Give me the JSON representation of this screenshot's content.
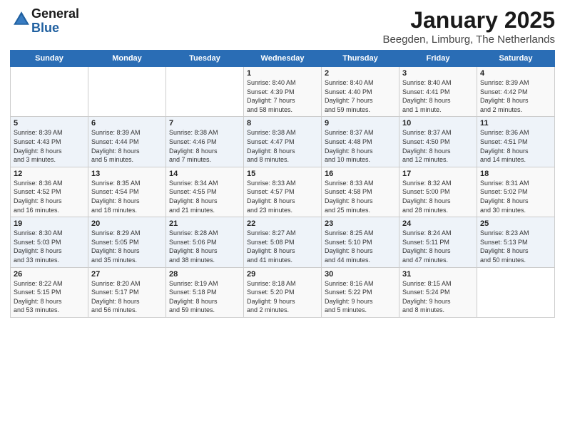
{
  "logo": {
    "general": "General",
    "blue": "Blue"
  },
  "title": "January 2025",
  "subtitle": "Beegden, Limburg, The Netherlands",
  "days_of_week": [
    "Sunday",
    "Monday",
    "Tuesday",
    "Wednesday",
    "Thursday",
    "Friday",
    "Saturday"
  ],
  "weeks": [
    [
      {
        "day": "",
        "text": ""
      },
      {
        "day": "",
        "text": ""
      },
      {
        "day": "",
        "text": ""
      },
      {
        "day": "1",
        "text": "Sunrise: 8:40 AM\nSunset: 4:39 PM\nDaylight: 7 hours\nand 58 minutes."
      },
      {
        "day": "2",
        "text": "Sunrise: 8:40 AM\nSunset: 4:40 PM\nDaylight: 7 hours\nand 59 minutes."
      },
      {
        "day": "3",
        "text": "Sunrise: 8:40 AM\nSunset: 4:41 PM\nDaylight: 8 hours\nand 1 minute."
      },
      {
        "day": "4",
        "text": "Sunrise: 8:39 AM\nSunset: 4:42 PM\nDaylight: 8 hours\nand 2 minutes."
      }
    ],
    [
      {
        "day": "5",
        "text": "Sunrise: 8:39 AM\nSunset: 4:43 PM\nDaylight: 8 hours\nand 3 minutes."
      },
      {
        "day": "6",
        "text": "Sunrise: 8:39 AM\nSunset: 4:44 PM\nDaylight: 8 hours\nand 5 minutes."
      },
      {
        "day": "7",
        "text": "Sunrise: 8:38 AM\nSunset: 4:46 PM\nDaylight: 8 hours\nand 7 minutes."
      },
      {
        "day": "8",
        "text": "Sunrise: 8:38 AM\nSunset: 4:47 PM\nDaylight: 8 hours\nand 8 minutes."
      },
      {
        "day": "9",
        "text": "Sunrise: 8:37 AM\nSunset: 4:48 PM\nDaylight: 8 hours\nand 10 minutes."
      },
      {
        "day": "10",
        "text": "Sunrise: 8:37 AM\nSunset: 4:50 PM\nDaylight: 8 hours\nand 12 minutes."
      },
      {
        "day": "11",
        "text": "Sunrise: 8:36 AM\nSunset: 4:51 PM\nDaylight: 8 hours\nand 14 minutes."
      }
    ],
    [
      {
        "day": "12",
        "text": "Sunrise: 8:36 AM\nSunset: 4:52 PM\nDaylight: 8 hours\nand 16 minutes."
      },
      {
        "day": "13",
        "text": "Sunrise: 8:35 AM\nSunset: 4:54 PM\nDaylight: 8 hours\nand 18 minutes."
      },
      {
        "day": "14",
        "text": "Sunrise: 8:34 AM\nSunset: 4:55 PM\nDaylight: 8 hours\nand 21 minutes."
      },
      {
        "day": "15",
        "text": "Sunrise: 8:33 AM\nSunset: 4:57 PM\nDaylight: 8 hours\nand 23 minutes."
      },
      {
        "day": "16",
        "text": "Sunrise: 8:33 AM\nSunset: 4:58 PM\nDaylight: 8 hours\nand 25 minutes."
      },
      {
        "day": "17",
        "text": "Sunrise: 8:32 AM\nSunset: 5:00 PM\nDaylight: 8 hours\nand 28 minutes."
      },
      {
        "day": "18",
        "text": "Sunrise: 8:31 AM\nSunset: 5:02 PM\nDaylight: 8 hours\nand 30 minutes."
      }
    ],
    [
      {
        "day": "19",
        "text": "Sunrise: 8:30 AM\nSunset: 5:03 PM\nDaylight: 8 hours\nand 33 minutes."
      },
      {
        "day": "20",
        "text": "Sunrise: 8:29 AM\nSunset: 5:05 PM\nDaylight: 8 hours\nand 35 minutes."
      },
      {
        "day": "21",
        "text": "Sunrise: 8:28 AM\nSunset: 5:06 PM\nDaylight: 8 hours\nand 38 minutes."
      },
      {
        "day": "22",
        "text": "Sunrise: 8:27 AM\nSunset: 5:08 PM\nDaylight: 8 hours\nand 41 minutes."
      },
      {
        "day": "23",
        "text": "Sunrise: 8:25 AM\nSunset: 5:10 PM\nDaylight: 8 hours\nand 44 minutes."
      },
      {
        "day": "24",
        "text": "Sunrise: 8:24 AM\nSunset: 5:11 PM\nDaylight: 8 hours\nand 47 minutes."
      },
      {
        "day": "25",
        "text": "Sunrise: 8:23 AM\nSunset: 5:13 PM\nDaylight: 8 hours\nand 50 minutes."
      }
    ],
    [
      {
        "day": "26",
        "text": "Sunrise: 8:22 AM\nSunset: 5:15 PM\nDaylight: 8 hours\nand 53 minutes."
      },
      {
        "day": "27",
        "text": "Sunrise: 8:20 AM\nSunset: 5:17 PM\nDaylight: 8 hours\nand 56 minutes."
      },
      {
        "day": "28",
        "text": "Sunrise: 8:19 AM\nSunset: 5:18 PM\nDaylight: 8 hours\nand 59 minutes."
      },
      {
        "day": "29",
        "text": "Sunrise: 8:18 AM\nSunset: 5:20 PM\nDaylight: 9 hours\nand 2 minutes."
      },
      {
        "day": "30",
        "text": "Sunrise: 8:16 AM\nSunset: 5:22 PM\nDaylight: 9 hours\nand 5 minutes."
      },
      {
        "day": "31",
        "text": "Sunrise: 8:15 AM\nSunset: 5:24 PM\nDaylight: 9 hours\nand 8 minutes."
      },
      {
        "day": "",
        "text": ""
      }
    ]
  ]
}
